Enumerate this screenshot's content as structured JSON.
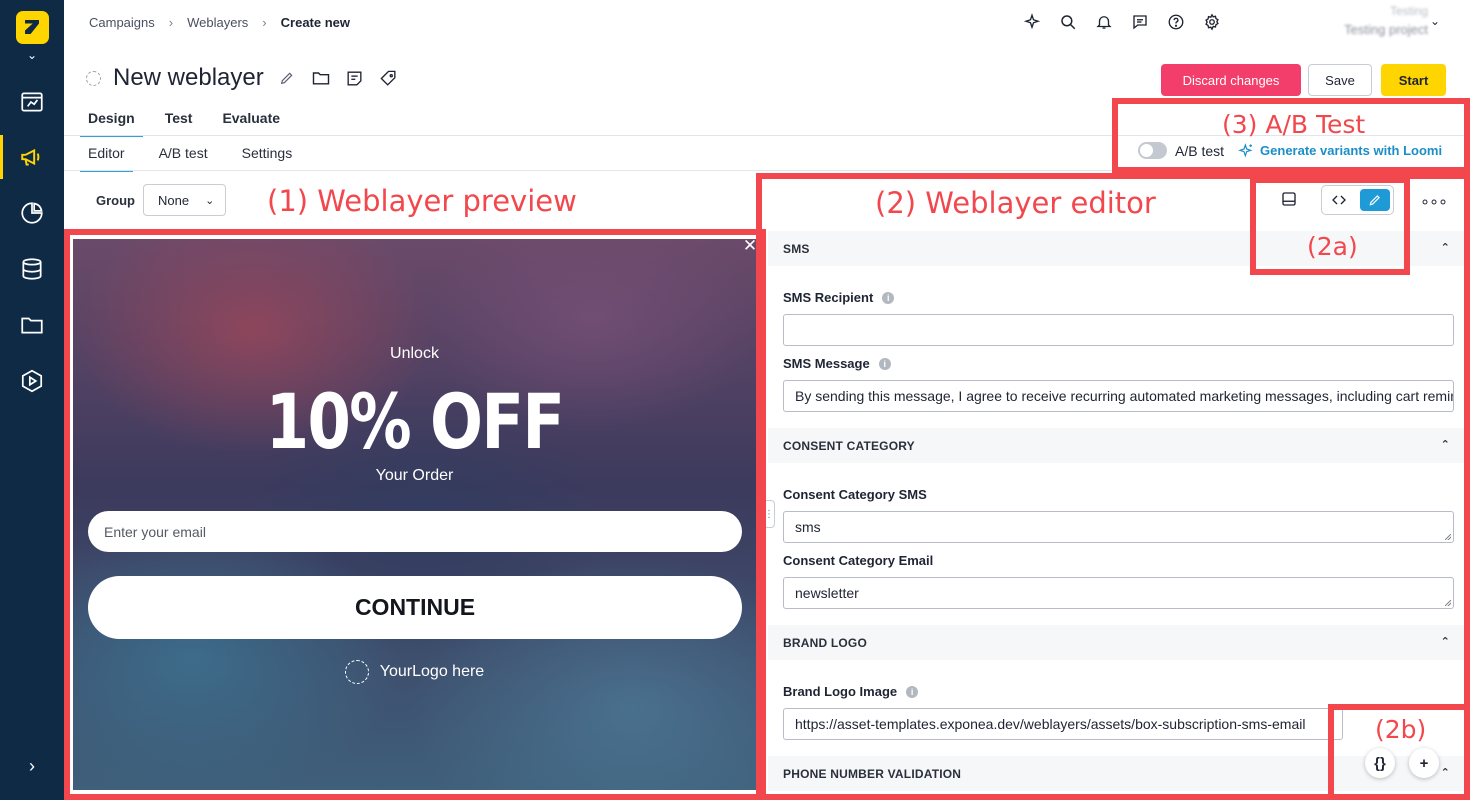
{
  "breadcrumb": [
    "Campaigns",
    "Weblayers",
    "Create new"
  ],
  "project": {
    "line1": "Testing",
    "line2": "Testing project"
  },
  "page_title": "New weblayer",
  "buttons": {
    "discard": "Discard changes",
    "save": "Save",
    "start": "Start"
  },
  "tabs_primary": [
    "Design",
    "Test",
    "Evaluate"
  ],
  "tabs_secondary": [
    "Editor",
    "A/B test",
    "Settings"
  ],
  "ab": {
    "toggle_label": "A/B test",
    "loomi_label": "Generate variants with Loomi"
  },
  "group": {
    "label": "Group",
    "value": "None"
  },
  "annotations": {
    "preview": "(1) Weblayer preview",
    "editor": "(2) Weblayer editor",
    "ab": "(3) A/B Test",
    "editor_toolbar": "(2a)",
    "editor_fabs": "(2b)"
  },
  "preview": {
    "unlock": "Unlock",
    "offer": "10% OFF",
    "order": "Your Order",
    "email_placeholder": "Enter your email",
    "continue": "CONTINUE",
    "logo": "YourLogo here"
  },
  "editor": {
    "sections": {
      "sms": "SMS",
      "consent": "CONSENT CATEGORY",
      "brand": "BRAND LOGO",
      "phone": "PHONE NUMBER VALIDATION"
    },
    "fields": {
      "sms_recipient_label": "SMS Recipient",
      "sms_recipient_value": "",
      "sms_message_label": "SMS Message",
      "sms_message_value": "By sending this message, I agree to receive recurring automated marketing messages, including cart reminders",
      "consent_sms_label": "Consent Category SMS",
      "consent_sms_value": "sms",
      "consent_email_label": "Consent Category Email",
      "consent_email_value": "newsletter",
      "brand_logo_label": "Brand Logo Image",
      "brand_logo_value": "https://asset-templates.exponea.dev/weblayers/assets/box-subscription-sms-email"
    }
  },
  "colors": {
    "annotation": "#f2474c",
    "accent": "#ffd500",
    "discard": "#f33d6a",
    "link": "#1a8fc7",
    "rail": "#0f2a44"
  }
}
